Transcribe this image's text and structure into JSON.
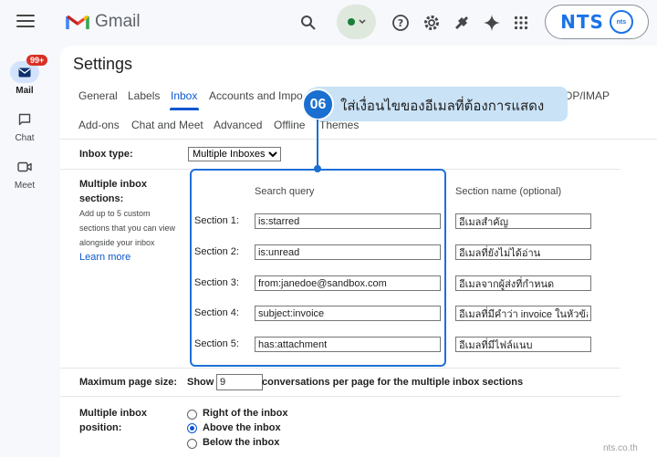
{
  "header": {
    "app_name": "Gmail",
    "brand": "NTS",
    "brand_badge": "nts",
    "icons": [
      "menu-icon",
      "gmail-logo-icon",
      "search-icon",
      "status-dot-icon",
      "chevron-down-icon",
      "help-icon",
      "gear-icon",
      "puzzle-icon",
      "sparkle-icon",
      "apps-grid-icon"
    ]
  },
  "rail": {
    "mail_label": "Mail",
    "mail_badge": "99+",
    "chat_label": "Chat",
    "meet_label": "Meet"
  },
  "settings": {
    "title": "Settings",
    "tabs_row1": [
      "General",
      "Labels",
      "Inbox",
      "Accounts and Impo",
      "OP/IMAP"
    ],
    "tabs_row2": [
      "Add-ons",
      "Chat and Meet",
      "Advanced",
      "Offline",
      "Themes"
    ],
    "active_tab": "Inbox"
  },
  "inbox_type": {
    "label": "Inbox type:",
    "value": "Multiple Inboxes"
  },
  "multiple_sections": {
    "label_line1": "Multiple inbox",
    "label_line2": "sections:",
    "help_line1": "Add up to 5 custom",
    "help_line2": "sections that you can view",
    "help_line3": "alongside your inbox",
    "learn_more": "Learn more",
    "query_header": "Search query",
    "name_header": "Section name (optional)",
    "rows": [
      {
        "label": "Section 1:",
        "query": "is:starred",
        "name": "อีเมลสำคัญ"
      },
      {
        "label": "Section 2:",
        "query": "is:unread",
        "name": "อีเมลที่ยังไม่ได้อ่าน"
      },
      {
        "label": "Section 3:",
        "query": "from:janedoe@sandbox.com",
        "name": "อีเมลจากผู้ส่งที่กำหนด"
      },
      {
        "label": "Section 4:",
        "query": "subject:invoice",
        "name": "อีเมลที่มีคำว่า invoice ในหัวข้อ"
      },
      {
        "label": "Section 5:",
        "query": "has:attachment",
        "name": "อีเมลที่มีไฟล์แนบ"
      }
    ]
  },
  "page_size": {
    "label": "Maximum page size:",
    "show": "Show",
    "value": "9",
    "suffix": "conversations per page for the multiple inbox sections"
  },
  "position": {
    "label_line1": "Multiple inbox",
    "label_line2": "position:",
    "options": [
      "Right of the inbox",
      "Above the inbox",
      "Below the inbox"
    ],
    "selected": "Above the inbox"
  },
  "callout": {
    "number": "06",
    "text": "ใส่เงื่อนไขของอีเมลที่ต้องการแสดง"
  },
  "watermark": "nts.co.th",
  "colors": {
    "accent": "#0b57d0",
    "callout_bg": "#c9e2f6",
    "callout_badge": "#1a6fd0",
    "mail_badge": "#d93025"
  }
}
